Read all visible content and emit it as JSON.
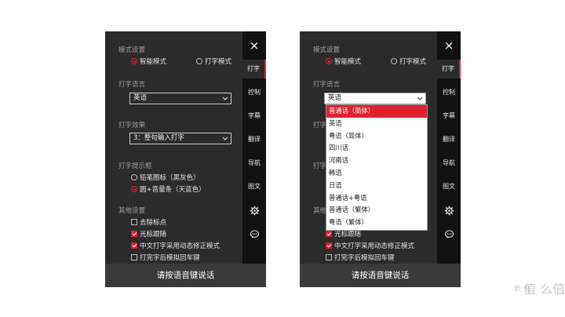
{
  "colors": {
    "accent": "#e0202e",
    "panel": "#2b2b2b",
    "sidebar": "#111111",
    "footer": "#3a3a3a"
  },
  "sidebar": {
    "close_icon": "×",
    "tabs": [
      "打字",
      "控制",
      "字幕",
      "翻译",
      "导航",
      "图文"
    ],
    "icons": [
      "gear-icon",
      "chat-icon"
    ]
  },
  "sections": {
    "mode": {
      "title": "模式设置",
      "options": [
        "智能模式",
        "打字模式"
      ],
      "selected": 0
    },
    "language": {
      "title": "打字语言",
      "value": "英语"
    },
    "effect": {
      "title": "打字效果",
      "value": "3：整句输入打字"
    },
    "hint": {
      "title": "打字提示框",
      "options": [
        "铅笔图标（黑灰色）",
        "圆+音量条（天蓝色）"
      ],
      "selected": 1
    },
    "other": {
      "title": "其他设置",
      "options": [
        {
          "label": "去除标点",
          "checked": false
        },
        {
          "label": "光标跟随",
          "checked": true
        },
        {
          "label": "中文打字采用动态修正模式",
          "checked": true
        },
        {
          "label": "打完字后模拟回车键",
          "checked": false
        }
      ]
    }
  },
  "footer": {
    "label": "请按语音键说话"
  },
  "dropdown": {
    "items": [
      "普通话（简体）",
      "英语",
      "粤语（简体）",
      "四川话",
      "河南话",
      "韩语",
      "日语",
      "普通话+粤语",
      "普通话（繁体）",
      "粤语（繁体）"
    ],
    "selected": 0
  },
  "watermark": {
    "main": "值 么值得买",
    "small": "新 浪"
  }
}
